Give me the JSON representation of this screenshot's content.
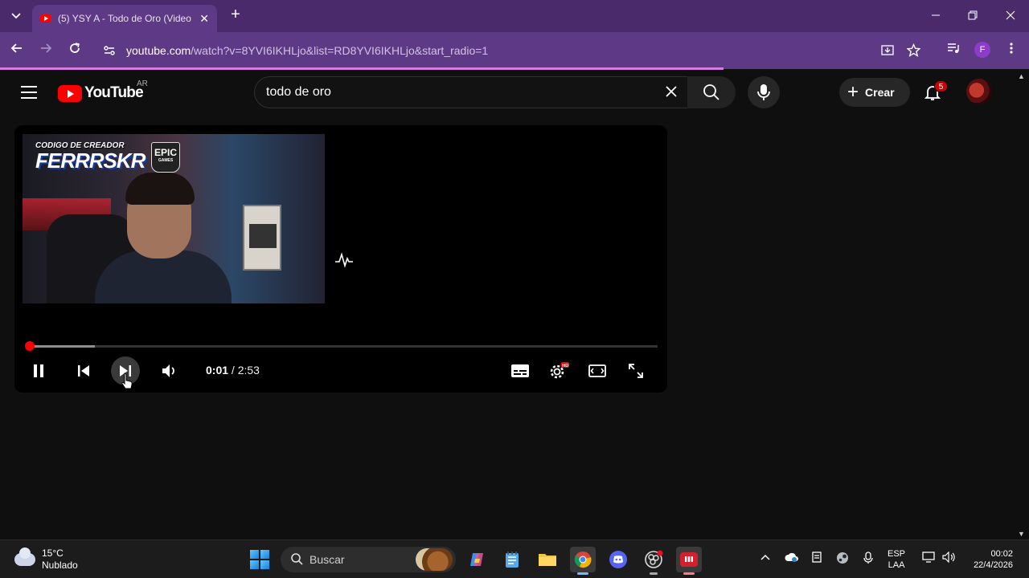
{
  "browser": {
    "tab_title": "(5) YSY A - Todo de Oro (Video",
    "tab_close": "✕",
    "new_tab": "+",
    "url_main": "youtube.com",
    "url_rest": "/watch?v=8YVI6IKHLjo&list=RD8YVI6IKHLjo&start_radio=1",
    "profile_initial": "F"
  },
  "youtube": {
    "logo_text": "YouTube",
    "country_code": "AR",
    "search_value": "todo de oro",
    "create_label": "Crear",
    "notification_count": "5"
  },
  "video": {
    "overlay_small": "CODIGO DE CREADOR",
    "overlay_big": "FERRRSKR",
    "epic_line1": "EPIC",
    "epic_line2": "GAMES"
  },
  "player": {
    "current_time": "0:01",
    "separator": " / ",
    "duration": "2:53",
    "played_fraction": 0.006,
    "buffered_fraction": 0.11
  },
  "taskbar": {
    "temperature": "15°C",
    "weather": "Nublado",
    "search_placeholder": "Buscar",
    "lang_line1": "ESP",
    "lang_line2": "LAA",
    "time": "00:02",
    "date": "22/4/2026"
  },
  "colors": {
    "yt_red": "#ff0000",
    "chrome_tab": "#4a2a6b",
    "chrome_toolbar": "#5e3a86"
  }
}
